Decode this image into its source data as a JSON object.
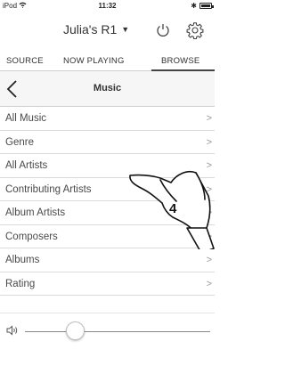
{
  "status_bar": {
    "carrier": "iPod",
    "time": "11:32",
    "bluetooth": "✱"
  },
  "device": {
    "name": "Julia's R1"
  },
  "tabs": [
    {
      "label": "SOURCE"
    },
    {
      "label": "NOW PLAYING"
    },
    {
      "label": "BROWSE",
      "selected": true
    }
  ],
  "nav": {
    "title": "Music"
  },
  "list": {
    "items": [
      {
        "label": "All Music"
      },
      {
        "label": "Genre"
      },
      {
        "label": "All Artists"
      },
      {
        "label": "Contributing Artists"
      },
      {
        "label": "Album Artists"
      },
      {
        "label": "Composers"
      },
      {
        "label": "Albums"
      },
      {
        "label": "Rating"
      }
    ]
  },
  "volume": {
    "level": 0.27
  },
  "callout": {
    "step": "4"
  },
  "icons": [
    "wifi-icon",
    "battery-icon",
    "power-icon",
    "gear-icon",
    "back-icon",
    "chevron-right-icon",
    "speaker-icon",
    "pointing-hand-icon"
  ]
}
